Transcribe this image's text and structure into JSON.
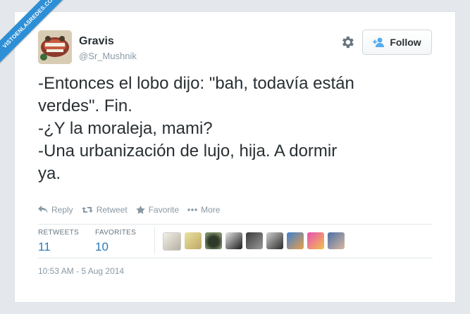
{
  "watermark": "VISTOENLASREDES.COM",
  "user": {
    "name": "Gravis",
    "handle": "@Sr_Mushnik"
  },
  "follow_label": "Follow",
  "tweet_lines": [
    "-Entonces el lobo dijo: \"bah, todavía están",
    "verdes\". Fin.",
    "-¿Y la moraleja, mami?",
    "-Una urbanización de lujo, hija. A dormir",
    "ya."
  ],
  "actions": {
    "reply": "Reply",
    "retweet": "Retweet",
    "favorite": "Favorite",
    "more": "More"
  },
  "stats": {
    "retweets_label": "RETWEETS",
    "retweets_count": "11",
    "favorites_label": "FAVORITES",
    "favorites_count": "10"
  },
  "timestamp": "10:53 AM - 5 Aug 2014",
  "colors": {
    "link": "#2b7bb9",
    "ribbon": "#2d8fd5",
    "muted": "#8899a6",
    "text": "#292f33"
  },
  "icons": [
    "gear-icon",
    "add-user-icon",
    "reply-icon",
    "retweet-icon",
    "star-icon",
    "more-icon"
  ]
}
